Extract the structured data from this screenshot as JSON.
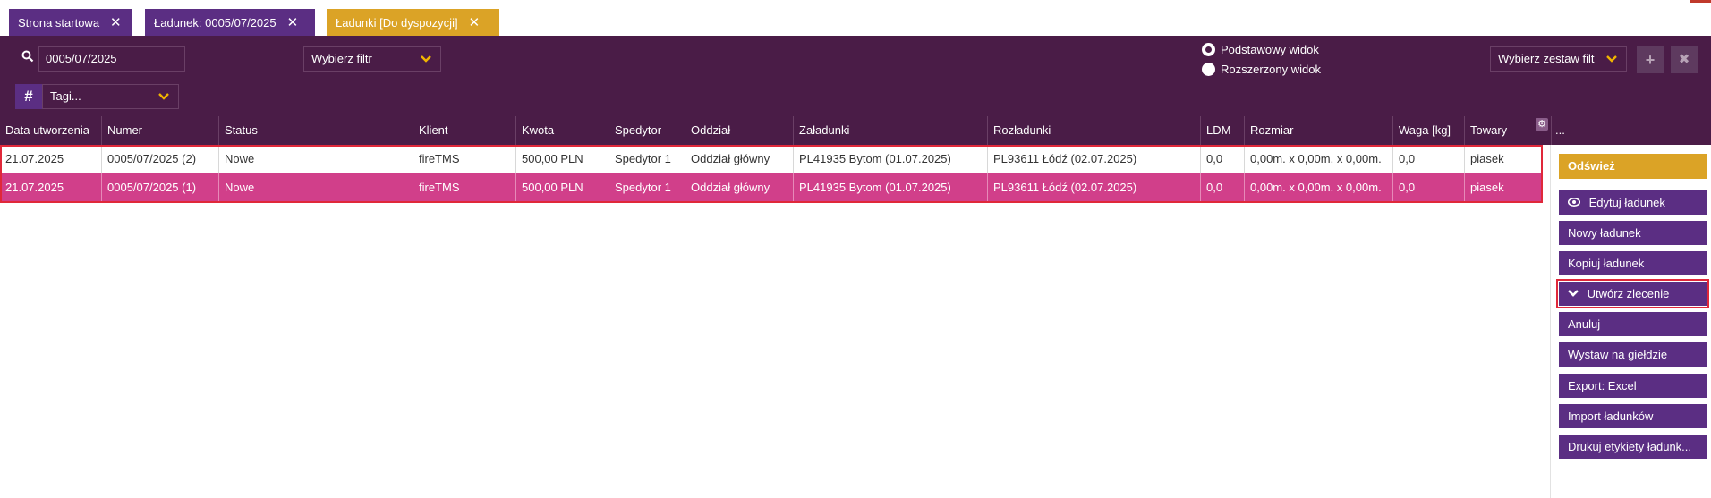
{
  "tabs": [
    {
      "label": "Strona startowa",
      "close": "✕"
    },
    {
      "label": "Ładunek: 0005/07/2025",
      "close": "✕"
    },
    {
      "label": "Ładunki [Do dyspozycji]",
      "close": "✕"
    }
  ],
  "toolbar": {
    "search_value": "0005/07/2025",
    "filter_select": "Wybierz filtr",
    "tags_select": "Tagi...",
    "tags_icon": "#",
    "view_basic": "Podstawowy widok",
    "view_extended": "Rozszerzony widok",
    "filter_set_select": "Wybierz zestaw filt",
    "add_icon": "+",
    "remove_icon": "✖"
  },
  "table": {
    "headers": [
      "Data utworzenia",
      "Numer",
      "Status",
      "Klient",
      "Kwota",
      "Spedytor",
      "Oddział",
      "Załadunki",
      "Rozładunki",
      "LDM",
      "Rozmiar",
      "Waga [kg]",
      "Towary"
    ],
    "extra_header": "...",
    "rows": [
      [
        "21.07.2025",
        "0005/07/2025 (2)",
        "Nowe",
        "fireTMS",
        "500,00 PLN",
        "Spedytor 1",
        "Oddział główny",
        "PL41935 Bytom (01.07.2025)",
        "PL93611 Łódź (02.07.2025)",
        "0,0",
        "0,00m. x 0,00m. x 0,00m.",
        "0,0",
        "piasek"
      ],
      [
        "21.07.2025",
        "0005/07/2025 (1)",
        "Nowe",
        "fireTMS",
        "500,00 PLN",
        "Spedytor 1",
        "Oddział główny",
        "PL41935 Bytom (01.07.2025)",
        "PL93611 Łódź (02.07.2025)",
        "0,0",
        "0,00m. x 0,00m. x 0,00m.",
        "0,0",
        "piasek"
      ]
    ],
    "selected_row": 1
  },
  "sidebar": {
    "refresh": "Odśwież",
    "edit": "Edytuj ładunek",
    "new": "Nowy ładunek",
    "copy": "Kopiuj ładunek",
    "create_order": "Utwórz zlecenie",
    "cancel": "Anuluj",
    "exchange": "Wystaw na giełdzie",
    "export": "Export: Excel",
    "import": "Import ładunków",
    "print_labels": "Drukuj etykiety ładunk..."
  },
  "colors": {
    "header_bg": "#4a1c47",
    "tab_purple": "#5b2e83",
    "tab_active": "#dba326",
    "selected_row": "#d13f8a",
    "highlight": "#e0283a"
  },
  "icons": [
    "search-icon",
    "chevron-down-icon",
    "hash-icon",
    "plus-icon",
    "close-icon",
    "eye-icon",
    "gear-icon"
  ]
}
